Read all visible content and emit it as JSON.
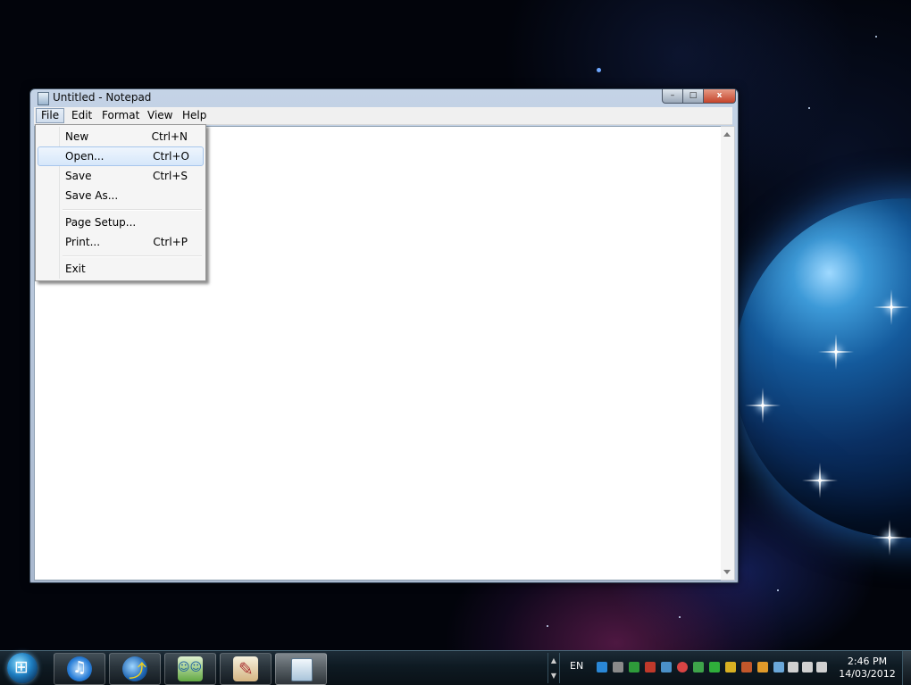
{
  "window": {
    "title": "Untitled - Notepad",
    "controls": {
      "minimize": "–",
      "maximize": "□",
      "close": "x"
    }
  },
  "menubar": {
    "items": [
      "File",
      "Edit",
      "Format",
      "View",
      "Help"
    ]
  },
  "file_menu": {
    "items": [
      {
        "label": "New",
        "shortcut": "Ctrl+N"
      },
      {
        "label": "Open...",
        "shortcut": "Ctrl+O"
      },
      {
        "label": "Save",
        "shortcut": "Ctrl+S"
      },
      {
        "label": "Save As...",
        "shortcut": ""
      },
      {
        "label": "Page Setup...",
        "shortcut": ""
      },
      {
        "label": "Print...",
        "shortcut": "Ctrl+P"
      },
      {
        "label": "Exit",
        "shortcut": ""
      }
    ],
    "highlighted": "Open..."
  },
  "editor": {
    "text": ""
  },
  "taskbar": {
    "pinned": [
      "itunes-icon",
      "globe-download-icon",
      "messenger-icon",
      "paint-icon",
      "notepad-icon"
    ],
    "active": "notepad-icon",
    "tray": {
      "language": "EN",
      "time": "2:46 PM",
      "date": "14/03/2012"
    }
  }
}
